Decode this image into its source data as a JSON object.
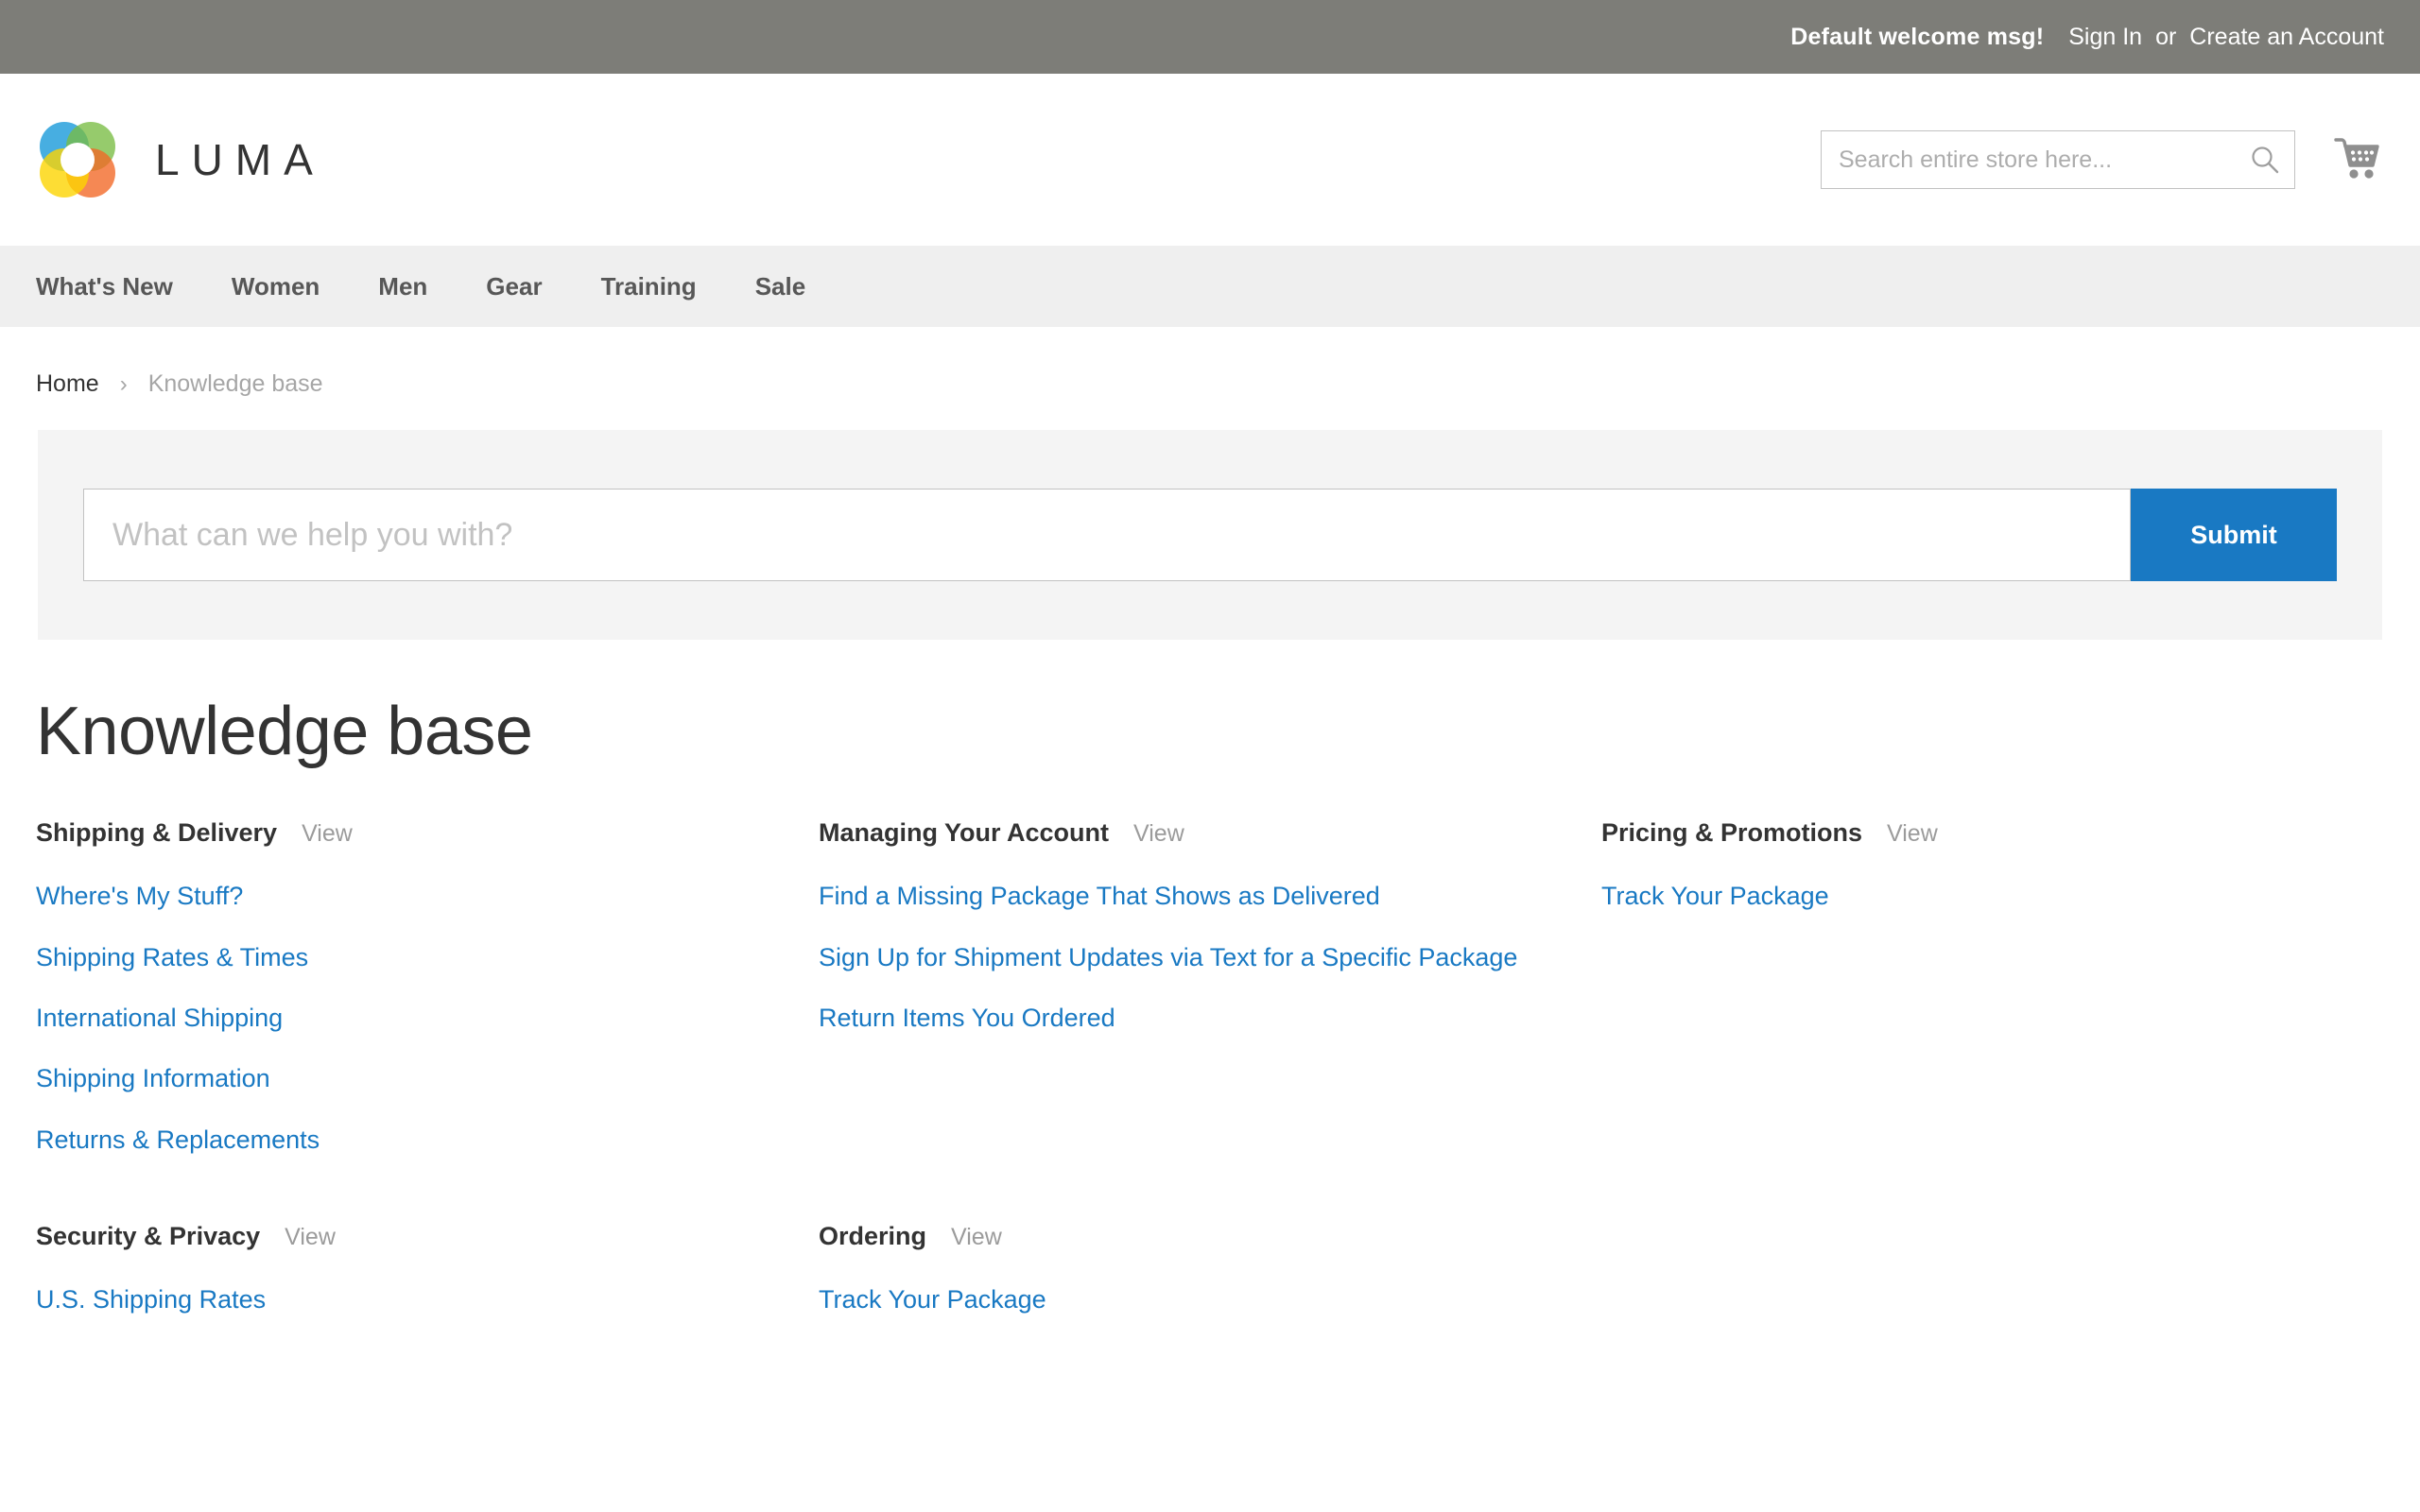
{
  "top_panel": {
    "welcome": "Default welcome msg!",
    "sign_in": "Sign In",
    "separator": "or",
    "create_account": "Create an Account"
  },
  "header": {
    "logo_text": "LUMA",
    "search": {
      "placeholder": "Search entire store here...",
      "value": ""
    },
    "cart_icon": "shopping-cart-icon",
    "search_icon": "search-icon"
  },
  "nav": {
    "items": [
      {
        "label": "What's New"
      },
      {
        "label": "Women"
      },
      {
        "label": "Men"
      },
      {
        "label": "Gear"
      },
      {
        "label": "Training"
      },
      {
        "label": "Sale"
      }
    ]
  },
  "breadcrumbs": {
    "home": "Home",
    "chevron": "›",
    "current": "Knowledge base"
  },
  "kb_search": {
    "placeholder": "What can we help you with?",
    "value": "",
    "submit_label": "Submit"
  },
  "page": {
    "title": "Knowledge base"
  },
  "categories": [
    {
      "title": "Shipping & Delivery",
      "view_label": "View",
      "articles": [
        "Where's My Stuff?",
        "Shipping Rates & Times",
        "International Shipping",
        "Shipping Information",
        "Returns & Replacements"
      ]
    },
    {
      "title": "Managing Your Account",
      "view_label": "View",
      "articles": [
        "Find a Missing Package That Shows as Delivered",
        "Sign Up for Shipment Updates via Text for a Specific Package",
        "Return Items You Ordered"
      ]
    },
    {
      "title": "Pricing & Promotions",
      "view_label": "View",
      "articles": [
        "Track Your Package"
      ]
    },
    {
      "title": "Security & Privacy",
      "view_label": "View",
      "articles": [
        "U.S. Shipping Rates"
      ]
    },
    {
      "title": "Ordering",
      "view_label": "View",
      "articles": [
        "Track Your Package"
      ]
    }
  ],
  "colors": {
    "top_panel_bg": "#7d7d78",
    "nav_bg": "#efefef",
    "link_blue": "#1979c3",
    "submit_bg": "#1979c3",
    "search_block_bg": "#f4f4f4",
    "muted_text": "#9b9b9b",
    "body_text": "#333333"
  }
}
